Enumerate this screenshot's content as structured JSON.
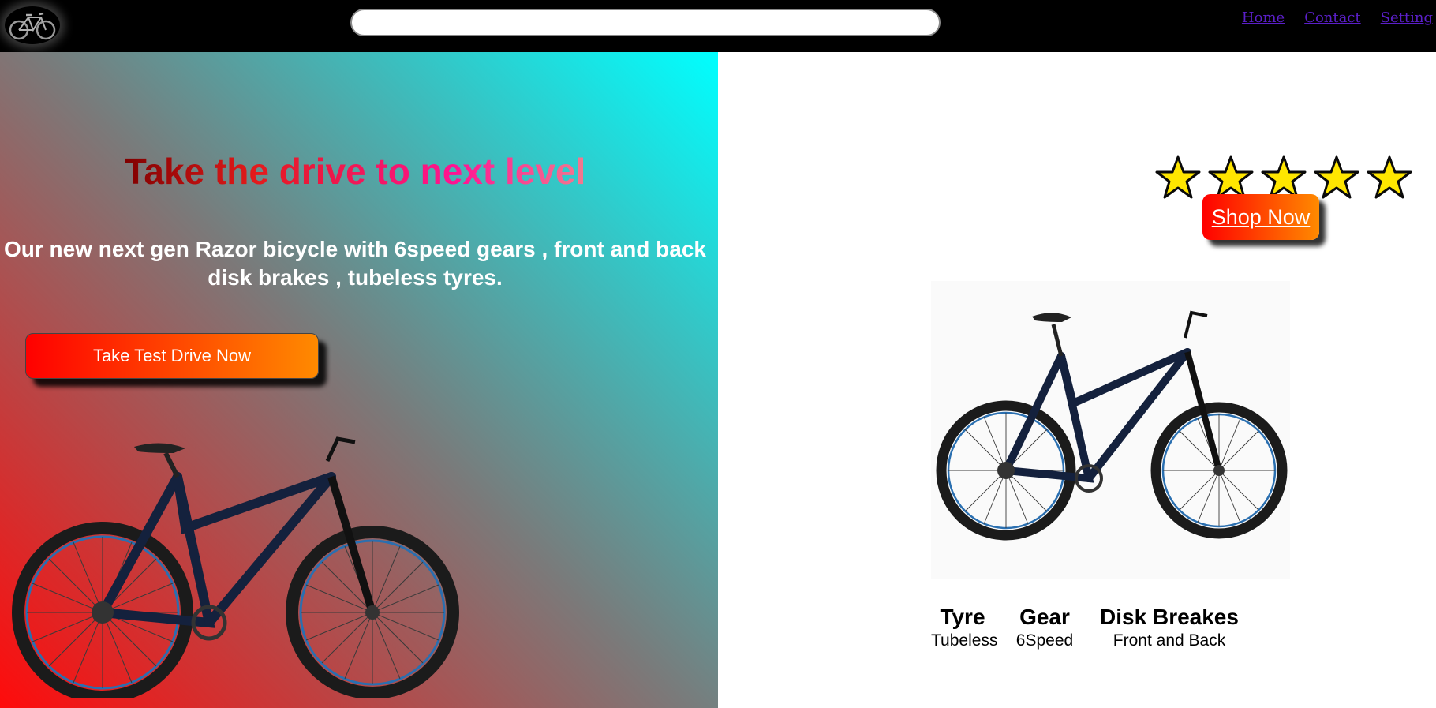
{
  "header": {
    "logo_icon": "bicycle-icon",
    "search": {
      "value": "",
      "placeholder": ""
    },
    "nav": [
      {
        "label": "Home"
      },
      {
        "label": "Contact"
      },
      {
        "label": "Setting"
      }
    ]
  },
  "hero": {
    "title": "Take the drive to next level",
    "description": "Our new next gen Razor bicycle with 6speed gears , front and back disk brakes , tubeless tyres.",
    "cta_label": "Take Test Drive Now",
    "gradient_colors": [
      "#ff0b0b",
      "#7a7a7a",
      "#00ffff"
    ]
  },
  "product": {
    "rating": {
      "value": 5,
      "max": 5
    },
    "shop_label": "Shop Now",
    "specs": [
      {
        "name": "Tyre",
        "value": "Tubeless"
      },
      {
        "name": "Gear",
        "value": "6Speed"
      },
      {
        "name": "Disk Breakes",
        "value": "Front and Back"
      }
    ]
  },
  "colors": {
    "button_gradient": [
      "#ff0000",
      "#ff8a00"
    ],
    "nav_link": "#5b1fc9",
    "star_fill": "#ffe600"
  }
}
